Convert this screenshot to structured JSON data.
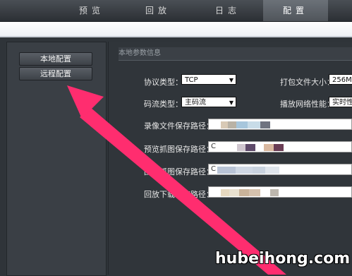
{
  "nav": {
    "tabs": [
      {
        "label": "预览"
      },
      {
        "label": "回放"
      },
      {
        "label": "日志"
      },
      {
        "label": "配置"
      }
    ]
  },
  "sidebar": {
    "items": [
      {
        "label": "本地配置"
      },
      {
        "label": "远程配置"
      }
    ]
  },
  "main": {
    "section_title": "本地参数信息",
    "fields": {
      "protocol": {
        "label": "协议类型：",
        "value": "TCP"
      },
      "stream": {
        "label": "码流类型：",
        "value": "主码流"
      },
      "pack_size": {
        "label": "打包文件大小：",
        "value": "256M"
      },
      "playback_perf": {
        "label": "播放网络性能：",
        "value": "实时性"
      },
      "record_path": {
        "label": "录像文件保存路径："
      },
      "snapshot_path": {
        "label": "预览抓图保存路径：",
        "value": "C"
      },
      "playback_snap_path": {
        "label": "回放抓图保存路径：",
        "value": "C"
      },
      "download_path": {
        "label": "回放下载保存路径："
      }
    }
  },
  "annotation": {
    "color": "#ff2d6f"
  },
  "watermark": {
    "text": "hubeihong.com"
  }
}
